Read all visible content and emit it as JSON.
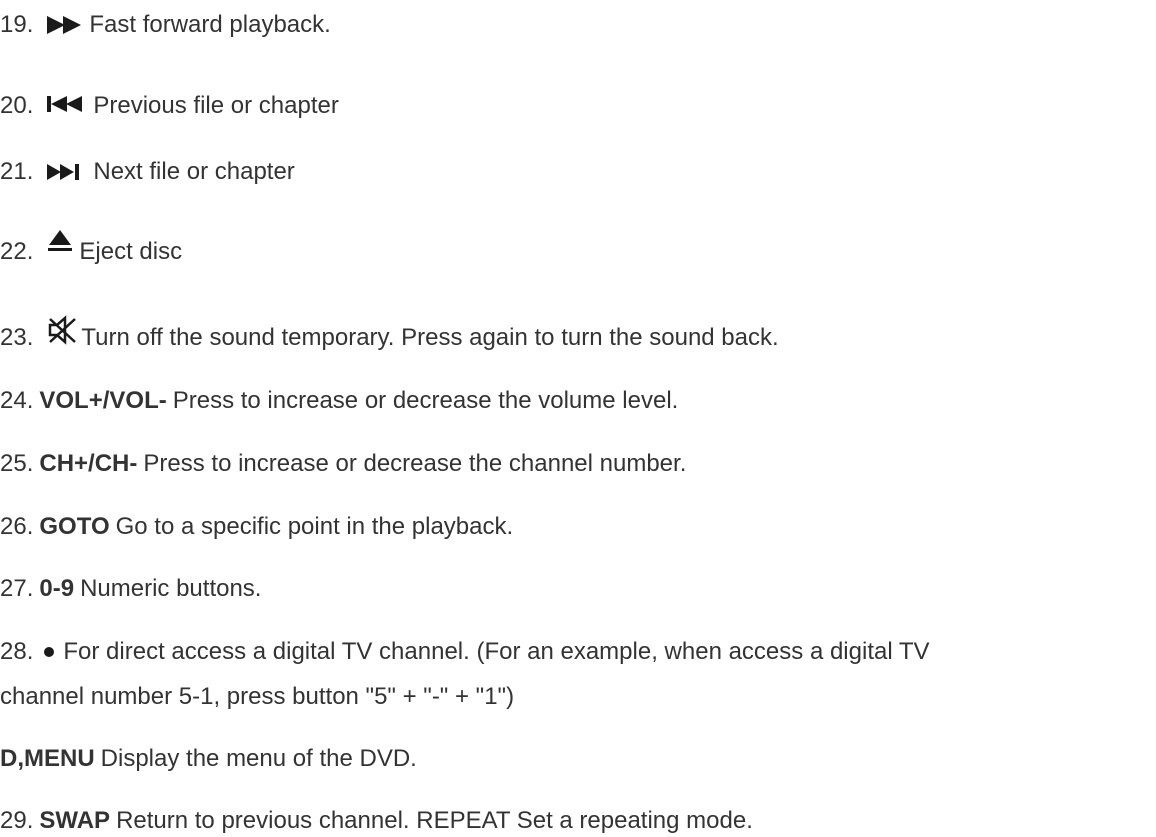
{
  "items": [
    {
      "num": "19.",
      "icon": "fast-forward-icon",
      "text": "Fast forward playback."
    },
    {
      "num": "20.",
      "icon": "previous-track-icon",
      "text": "Previous file or chapter"
    },
    {
      "num": "21.",
      "icon": "next-track-icon",
      "text": "Next file or chapter"
    },
    {
      "num": "22.",
      "icon": "eject-icon",
      "text": "Eject disc"
    },
    {
      "num": "23.",
      "icon": "mute-icon",
      "text": "Turn off the sound temporary. Press again to turn the sound back."
    },
    {
      "num": "24.",
      "key": "VOL+/VOL-",
      "text": "Press to increase or decrease the volume level."
    },
    {
      "num": "25.",
      "key": "CH+/CH-",
      "text": "Press to increase or decrease the channel number."
    },
    {
      "num": "26.",
      "key": "GOTO",
      "text": "Go to a specific point in the playback."
    },
    {
      "num": "27.",
      "key": "0-9",
      "text": "Numeric buttons."
    },
    {
      "num": "28.",
      "icon": "dot-icon",
      "text_line1": "For direct access a digital TV channel. (For an example, when access a digital TV",
      "text_line2": "channel number 5-1, press button \"5\" + \"-\" + \"1\")"
    },
    {
      "key": "D,MENU",
      "text": "Display the menu of the DVD."
    },
    {
      "num": "29.",
      "key": "SWAP",
      "text": "Return to previous channel. REPEAT Set a repeating mode."
    }
  ],
  "colors": {
    "text": "#333333",
    "icon": "#1a1a1a",
    "background": "#ffffff"
  }
}
